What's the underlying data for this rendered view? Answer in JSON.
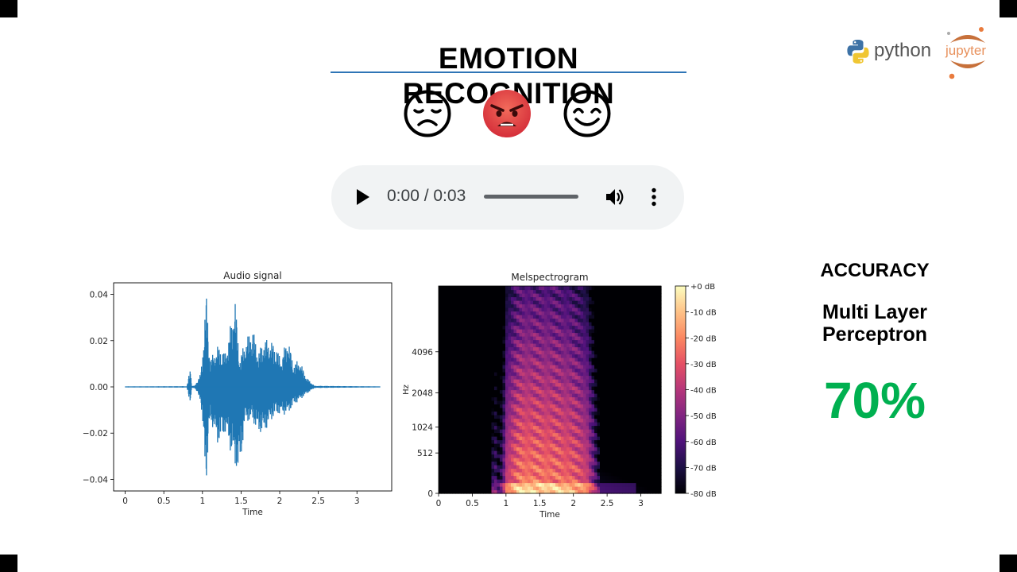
{
  "slide": {
    "title": "EMOTION RECOGNITION",
    "emojis": [
      {
        "icon": "sad-face-icon",
        "color": "#000000"
      },
      {
        "icon": "angry-face-icon",
        "color": "#e8383d"
      },
      {
        "icon": "smiling-face-icon",
        "color": "#000000"
      }
    ]
  },
  "audio_player": {
    "time_display": "0:00 / 0:03",
    "progress": 0.0,
    "icons": [
      "play-icon",
      "volume-icon",
      "more-options-icon"
    ]
  },
  "logos": {
    "python": "python",
    "jupyter": "jupyter"
  },
  "accuracy": {
    "heading": "ACCURACY",
    "model_line1": "Multi Layer",
    "model_line2": "Perceptron",
    "value": "70%",
    "value_color": "#00b050"
  },
  "chart_data": [
    {
      "type": "line",
      "title": "Audio signal",
      "xlabel": "Time",
      "ylabel": "",
      "xlim": [
        -0.15,
        3.45
      ],
      "ylim": [
        -0.045,
        0.045
      ],
      "x_ticks": [
        "0",
        "0.5",
        "1",
        "1.5",
        "2",
        "2.5",
        "3"
      ],
      "x_tick_values": [
        0,
        0.5,
        1,
        1.5,
        2,
        2.5,
        3
      ],
      "y_ticks": [
        "0.04",
        "0.02",
        "0.00",
        "−0.02",
        "−0.04"
      ],
      "y_tick_values": [
        0.04,
        0.02,
        0.0,
        -0.02,
        -0.04
      ],
      "color": "#1f77b4",
      "envelope": {
        "time": [
          0,
          0.8,
          0.84,
          0.85,
          0.86,
          0.9,
          0.98,
          1.0,
          1.05,
          1.1,
          1.2,
          1.3,
          1.38,
          1.42,
          1.48,
          1.55,
          1.65,
          1.72,
          1.8,
          1.88,
          1.95,
          2.02,
          2.1,
          2.18,
          2.25,
          2.35,
          2.45,
          3.3
        ],
        "upper": [
          0.0002,
          0.0003,
          0.008,
          0.008,
          0.0005,
          0.0005,
          0.006,
          0.015,
          0.041,
          0.012,
          0.018,
          0.015,
          0.03,
          0.04,
          0.012,
          0.02,
          0.026,
          0.015,
          0.021,
          0.02,
          0.018,
          0.012,
          0.022,
          0.01,
          0.012,
          0.004,
          0.0005,
          0.0002
        ],
        "lower": [
          -0.0002,
          -0.0003,
          -0.007,
          -0.007,
          -0.0005,
          -0.0005,
          -0.006,
          -0.018,
          -0.041,
          -0.014,
          -0.025,
          -0.02,
          -0.03,
          -0.035,
          -0.038,
          -0.015,
          -0.015,
          -0.02,
          -0.02,
          -0.015,
          -0.012,
          -0.012,
          -0.012,
          -0.008,
          -0.006,
          -0.003,
          -0.0005,
          -0.0002
        ]
      }
    },
    {
      "type": "heatmap",
      "title": "Melspectrogram",
      "xlabel": "Time",
      "ylabel": "Hz",
      "xlim": [
        0,
        3.3
      ],
      "x_ticks": [
        "0",
        "0.5",
        "1",
        "1.5",
        "2",
        "2.5",
        "3"
      ],
      "x_tick_values": [
        0,
        0.5,
        1,
        1.5,
        2,
        2.5,
        3
      ],
      "y_ticks": [
        "0",
        "512",
        "1024",
        "2048",
        "4096"
      ],
      "y_scale": "mel",
      "colormap": "magma",
      "colorbar": {
        "labels": [
          "+0 dB",
          "-10 dB",
          "-20 dB",
          "-30 dB",
          "-40 dB",
          "-50 dB",
          "-60 dB",
          "-70 dB",
          "-80 dB"
        ],
        "range_db": [
          -80,
          0
        ]
      },
      "energy_time": [
        0,
        0.78,
        0.82,
        0.88,
        0.95,
        1.0,
        1.2,
        1.5,
        1.8,
        2.0,
        2.2,
        2.3,
        2.4,
        3.3
      ],
      "energy_db": [
        -80,
        -80,
        -55,
        -70,
        -60,
        -35,
        -20,
        -20,
        -22,
        -25,
        -32,
        -50,
        -75,
        -80
      ]
    }
  ]
}
